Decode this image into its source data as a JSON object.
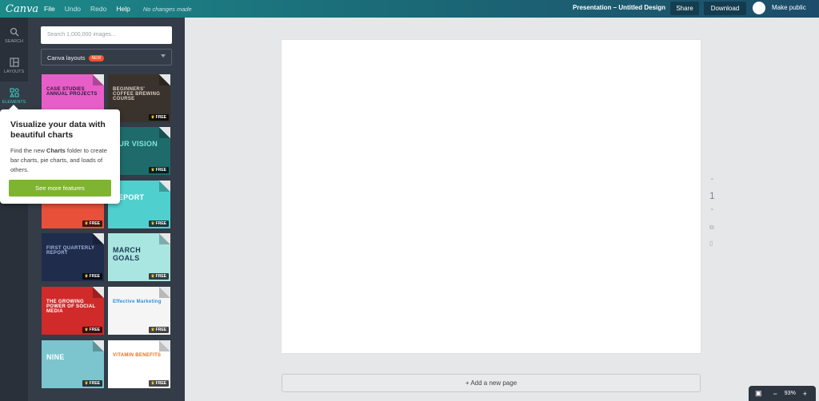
{
  "app": {
    "logo": "Canva",
    "menu": [
      {
        "label": "File",
        "dim": false
      },
      {
        "label": "Undo",
        "dim": true
      },
      {
        "label": "Redo",
        "dim": true
      },
      {
        "label": "Help",
        "dim": false
      }
    ],
    "status": "No changes made",
    "doc_title": "Presentation – Untitled Design",
    "share": "Share",
    "download": "Download",
    "make_public": "Make public"
  },
  "sidebar": {
    "items": [
      {
        "label": "SEARCH",
        "icon": "search-icon"
      },
      {
        "label": "LAYOUTS",
        "icon": "layouts-icon"
      },
      {
        "label": "ELEMENTS",
        "icon": "elements-icon"
      }
    ]
  },
  "panel": {
    "search_placeholder": "Search 1,000,000 images...",
    "dropdown_label": "Canva layouts",
    "new_badge": "NEW",
    "free_label": "FREE",
    "tiles": [
      {
        "title": "CASE STUDIES ANNUAL PROJECTS",
        "bg": "#e85ec8",
        "fg": "#2b1b3a",
        "free": false
      },
      {
        "title": "BEGINNERS' COFFEE BREWING COURSE",
        "bg": "#3a322c",
        "fg": "#d9cfc4",
        "free": true
      },
      {
        "title": "",
        "bg": "#e85ec8",
        "fg": "#2b1b3a",
        "free": false
      },
      {
        "title": "OUR VISION",
        "bg": "#1f6b6b",
        "fg": "#7fe7d8",
        "free": true
      },
      {
        "title": "online marketing",
        "bg": "#e8503a",
        "fg": "#ffffff",
        "free": true
      },
      {
        "title": "REPORT",
        "bg": "#4fd0cf",
        "fg": "#ffffff",
        "free": true
      },
      {
        "title": "FIRST QUARTERLY REPORT",
        "bg": "#1f2c4c",
        "fg": "#9fb2d9",
        "free": true
      },
      {
        "title": "MARCH GOALS",
        "bg": "#a9e6e2",
        "fg": "#1d3c55",
        "free": true
      },
      {
        "title": "THE GROWING POWER OF SOCIAL MEDIA",
        "bg": "#d02a2a",
        "fg": "#ffffff",
        "free": true
      },
      {
        "title": "Effective Marketing",
        "bg": "#f5f5f5",
        "fg": "#2a8ed8",
        "free": true
      },
      {
        "title": "NINE",
        "bg": "#7cc5cf",
        "fg": "#ffffff",
        "free": true
      },
      {
        "title": "VITAMIN BENEFITS",
        "bg": "#ffffff",
        "fg": "#e86f1f",
        "free": true
      }
    ]
  },
  "tooltip": {
    "title": "Visualize your data with beautiful charts",
    "body_before": "Find the new ",
    "body_bold": "Charts",
    "body_after": " folder to create bar charts, pie charts, and loads of others.",
    "button": "See more features"
  },
  "canvas": {
    "page_number": "1",
    "add_page": "+ Add a new page",
    "zoom": "93%"
  }
}
